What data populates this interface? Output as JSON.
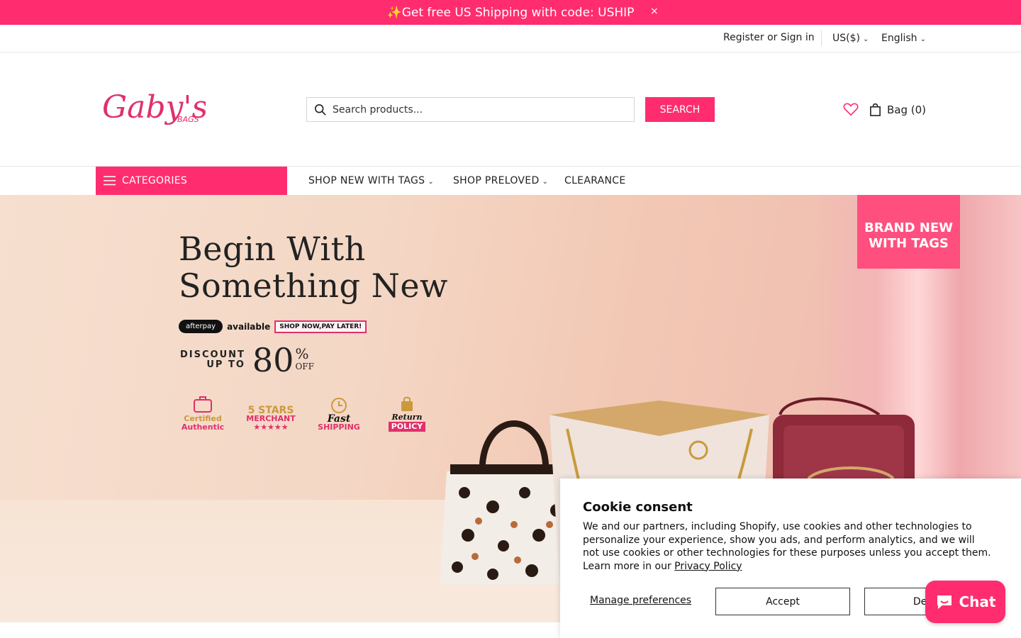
{
  "announcement": {
    "text": "✨Get free US Shipping with code: USHIP",
    "close": "×"
  },
  "topbar": {
    "register": "Register or Sign in",
    "currency": "US($)",
    "language": "English"
  },
  "header": {
    "logo_text": "Gaby's",
    "logo_sub": "BAGS",
    "search_placeholder": "Search products...",
    "search_button": "SEARCH",
    "bag_label": "Bag (0)"
  },
  "nav": {
    "categories": "CATEGORIES",
    "items": [
      {
        "label": "SHOP NEW WITH TAGS"
      },
      {
        "label": "SHOP PRELOVED"
      },
      {
        "label": "CLEARANCE"
      }
    ]
  },
  "hero": {
    "title_line1": "Begin With",
    "title_line2": "Something New",
    "afterpay": "afterpay",
    "available": "available",
    "shop_now": "SHOP NOW,PAY LATER!",
    "discount_line1": "DISCOUNT",
    "discount_line2": "UP TO",
    "discount_value": "80",
    "percent": "%",
    "off": "OFF",
    "ribbon_line1": "BRAND NEW",
    "ribbon_line2": "WITH TAGS",
    "badges": [
      {
        "line1": "Certified",
        "line2": "Authentic"
      },
      {
        "line1": "5 STARS",
        "line2": "MERCHANT"
      },
      {
        "line1": "Fast",
        "line2": "SHIPPING"
      },
      {
        "line1": "Return",
        "line2": "POLICY"
      }
    ]
  },
  "cookie": {
    "title": "Cookie consent",
    "body": "We and our partners, including Shopify, use cookies and other technologies to personalize your experience, show you ads, and perform analytics, and we will not use cookies or other technologies for these purposes unless you accept them. Learn more in our ",
    "link": "Privacy Policy",
    "manage": "Manage preferences",
    "accept": "Accept",
    "decline": "Decline"
  },
  "chat": {
    "label": "Chat"
  },
  "colors": {
    "brand": "#ff2d6f"
  }
}
